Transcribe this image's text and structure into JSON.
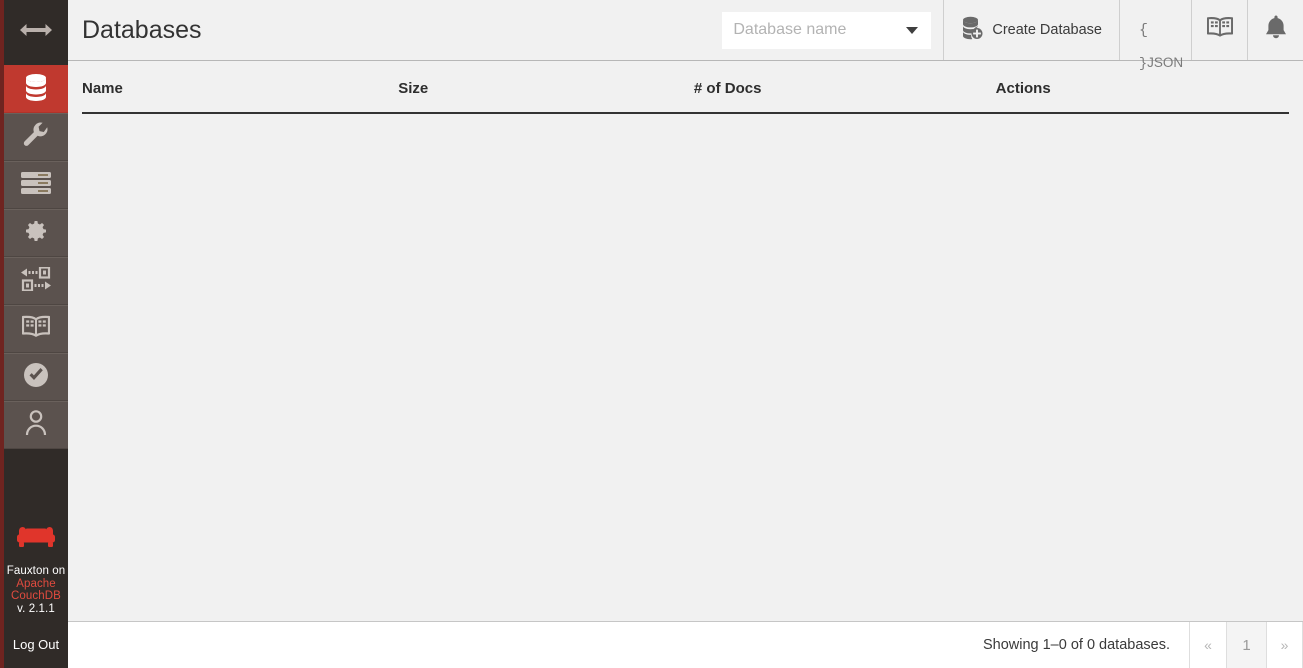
{
  "sidebar": {
    "toggle": {
      "icon": "arrows-horizontal-icon",
      "label": "Toggle navigation"
    },
    "items": [
      {
        "icon": "database-icon",
        "label": "Databases",
        "active": true
      },
      {
        "icon": "wrench-icon",
        "label": "Setup",
        "active": false
      },
      {
        "icon": "server-tasks-icon",
        "label": "Active Tasks",
        "active": false
      },
      {
        "icon": "gear-icon",
        "label": "Configuration",
        "active": false
      },
      {
        "icon": "replication-icon",
        "label": "Replication",
        "active": false
      },
      {
        "icon": "book-icon",
        "label": "Documentation",
        "active": false
      },
      {
        "icon": "check-circle-icon",
        "label": "Verify",
        "active": false
      },
      {
        "icon": "user-icon",
        "label": "Account",
        "active": false
      }
    ],
    "brand": {
      "logo": "couch-icon",
      "line1": "Fauxton on",
      "link1": "Apache",
      "link2": "CouchDB",
      "version": "v. 2.1.1"
    },
    "logout_label": "Log Out",
    "accent_color": "#c0392f",
    "background_color": "#302B28",
    "item_color": "#5b524e"
  },
  "header": {
    "title": "Databases",
    "search": {
      "placeholder": "Database name",
      "value": "",
      "caret_icon": "chevron-down-icon"
    },
    "create_database": {
      "icon": "database-plus-icon",
      "label": "Create Database"
    },
    "json_button": {
      "icon": "json-braces-icon",
      "brace_open": "{",
      "brace_close": "}",
      "label": "JSON"
    },
    "docs_button": {
      "icon": "book-icon"
    },
    "notifications_button": {
      "icon": "bell-icon"
    }
  },
  "table": {
    "columns": [
      {
        "key": "name",
        "label": "Name"
      },
      {
        "key": "size",
        "label": "Size"
      },
      {
        "key": "docs",
        "label": "# of Docs"
      },
      {
        "key": "actions",
        "label": "Actions"
      }
    ],
    "rows": []
  },
  "footer": {
    "showing_text": "Showing 1–0 of 0 databases.",
    "pagination": {
      "prev": "«",
      "pages": [
        "1"
      ],
      "next": "»",
      "current": "1"
    }
  }
}
